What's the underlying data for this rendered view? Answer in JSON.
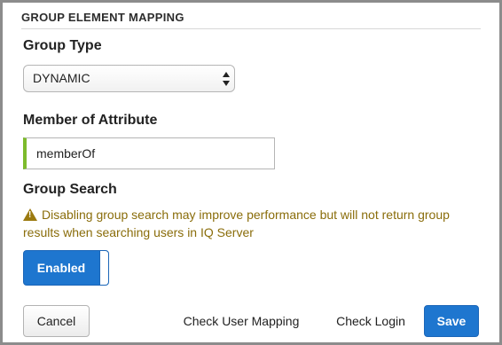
{
  "section": {
    "title": "GROUP ELEMENT MAPPING"
  },
  "group_type": {
    "label": "Group Type",
    "selected": "DYNAMIC",
    "icon": "select-arrows-icon"
  },
  "member_of_attribute": {
    "label": "Member of Attribute",
    "value": "memberOf",
    "accent_color": "#7dbb2c"
  },
  "group_search": {
    "label": "Group Search",
    "warning_icon": "warning-triangle-icon",
    "warning_text": "Disabling group search may improve performance but will not return group results when searching users in IQ Server",
    "warning_color": "#8a6d0b",
    "toggle_label": "Enabled",
    "toggle_state": "on"
  },
  "actions": {
    "cancel": "Cancel",
    "check_user_mapping": "Check User Mapping",
    "check_login": "Check Login",
    "save": "Save",
    "primary_color": "#1e76cf"
  }
}
